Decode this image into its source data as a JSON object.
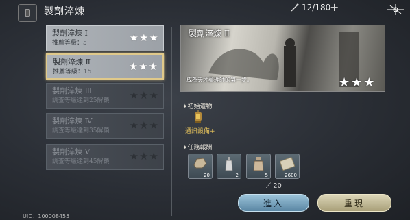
{
  "header": {
    "title": "製劑淬煉",
    "stamina": "12/180",
    "plus": "+"
  },
  "stages": [
    {
      "name": "製劑淬煉 Ⅰ",
      "requirement": "推薦等級：5",
      "stars": "★★★",
      "state": "unlocked"
    },
    {
      "name": "製劑淬煉 Ⅱ",
      "requirement": "推薦等級：15",
      "stars": "★★★",
      "state": "selected"
    },
    {
      "name": "製劑淬煉 Ⅲ",
      "requirement": "調查等級達到25解鎖",
      "stars": "★★★",
      "state": "locked"
    },
    {
      "name": "製劑淬煉 Ⅳ",
      "requirement": "調查等級達到35解鎖",
      "stars": "★★★",
      "state": "locked"
    },
    {
      "name": "製劑淬煉 Ⅴ",
      "requirement": "調查等級達到45解鎖",
      "stars": "★★★",
      "state": "locked"
    }
  ],
  "detail": {
    "title": "製劑淬煉 Ⅱ",
    "description": "成為天才藥理師的第一步。",
    "stars": "★★★",
    "artifact_label": "✦初始遺物",
    "artifact_name": "通訊設備+",
    "rewards_label": "✦任務報酬",
    "rewards": [
      {
        "count": "20",
        "icon": "ore-icon"
      },
      {
        "count": "2",
        "icon": "potion-bottle-icon"
      },
      {
        "count": "5",
        "icon": "essence-bottle-icon"
      },
      {
        "count": "2600",
        "icon": "banknote-icon"
      }
    ],
    "cost": "20"
  },
  "buttons": {
    "enter": "進入",
    "reset": "重現"
  },
  "footer": {
    "uid": "UID：100008455"
  }
}
